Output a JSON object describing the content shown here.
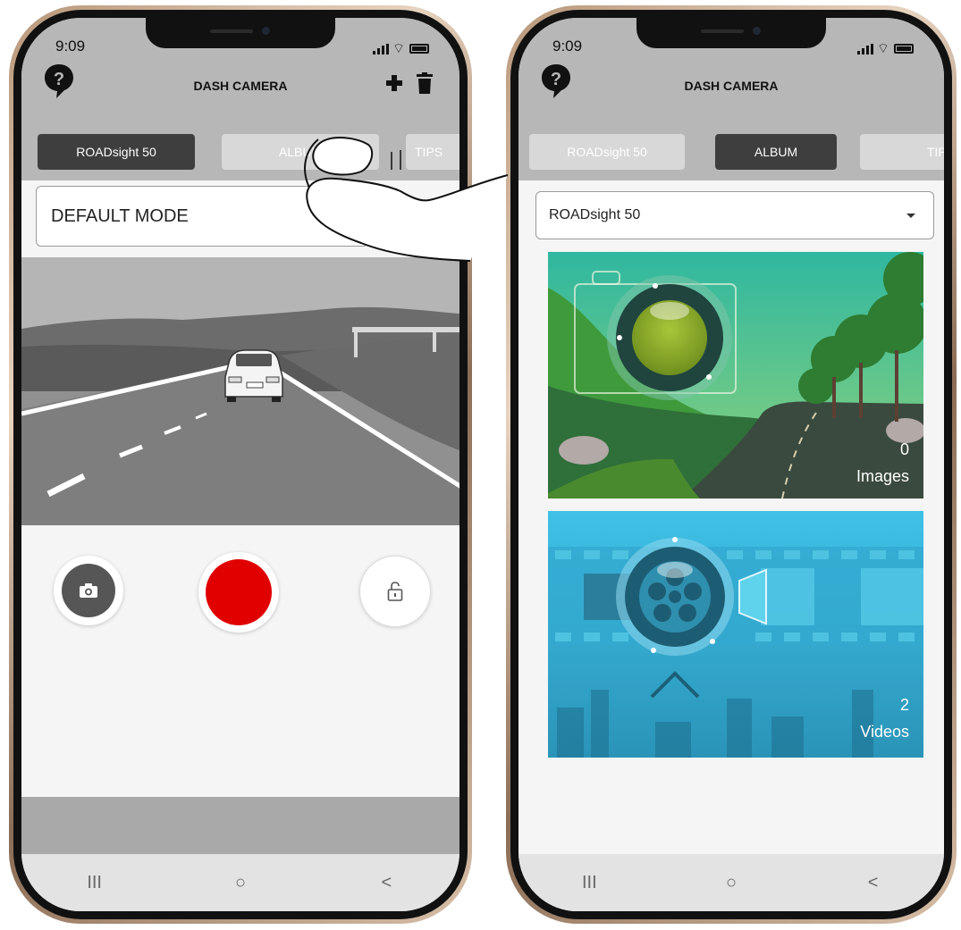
{
  "left_screen": {
    "status": {
      "time": "9:09"
    },
    "header": {
      "title": "DASH CAMERA"
    },
    "tabs": [
      {
        "label": "ROADsight 50",
        "active": true
      },
      {
        "label": "ALBUM",
        "active": false
      },
      {
        "label": "TIPS",
        "active": false
      }
    ],
    "mode_select": {
      "value": "DEFAULT MODE"
    },
    "controls": {
      "snapshot_icon": "camera-icon",
      "record_color": "#e00000",
      "lock_icon": "unlock-icon"
    },
    "nav": {
      "recents": "III",
      "home": "○",
      "back": "<"
    }
  },
  "right_screen": {
    "status": {
      "time": "9:09"
    },
    "header": {
      "title": "DASH CAMERA"
    },
    "tabs": [
      {
        "label": "ROADsight 50",
        "active": false
      },
      {
        "label": "ALBUM",
        "active": true
      },
      {
        "label": "TIPS",
        "active": false
      }
    ],
    "device_select": {
      "value": "ROADsight 50"
    },
    "albums": [
      {
        "count": "0",
        "label": "Images"
      },
      {
        "count": "2",
        "label": "Videos"
      }
    ],
    "nav": {
      "recents": "III",
      "home": "○",
      "back": "<"
    }
  },
  "colors": {
    "appbar": "#b7b7b7",
    "tab_active": "#3e3e3e",
    "record": "#e00000",
    "videos_bg": "#3ab6dc"
  }
}
